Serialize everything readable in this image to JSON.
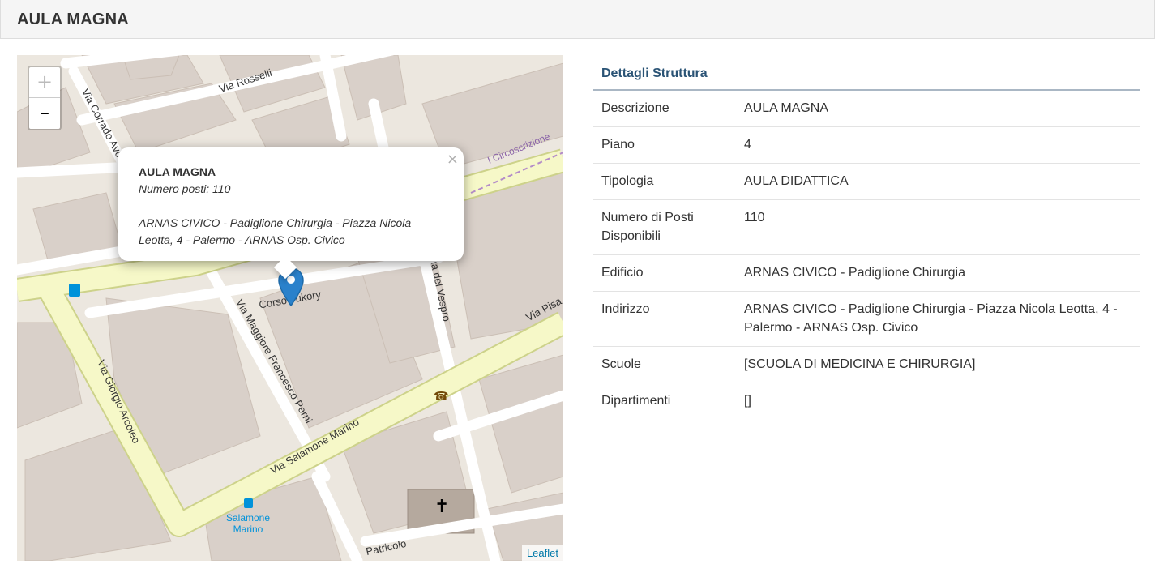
{
  "page": {
    "title": "AULA MAGNA"
  },
  "map": {
    "zoom_in": "+",
    "zoom_out": "–",
    "attribution": "Leaflet",
    "popup": {
      "title": "AULA MAGNA",
      "posti": "Numero posti: 110",
      "indirizzo": "ARNAS CIVICO - Padiglione Chirurgia - Piazza Nicola Leotta, 4 - Palermo - ARNAS Osp. Civico",
      "close": "×"
    },
    "street_labels": {
      "via_rosselli": "Via Rosselli",
      "via_corrado_avolio": "Via Corrado Avollo",
      "corso_tukory": "Corso Tukory",
      "via_maggiore": "Via Maggiore Francesco Perni",
      "via_salamone": "Via Salamone Marino",
      "via_giorgio": "Via Giorgio Arcoleo",
      "via_vespro": "Via del Vespro",
      "via_pisa": "Via Pisa",
      "circoscrizione": "I Circoscrizione",
      "bus_stop": "Salamone Marino",
      "patricolo": "Patricolo"
    },
    "icons": [
      "fuel-icon",
      "bus-stop-icon",
      "phone-icon",
      "church-cross-icon",
      "map-marker-icon"
    ]
  },
  "details": {
    "title": "Dettagli Struttura",
    "rows": [
      {
        "label": "Descrizione",
        "value": "AULA MAGNA"
      },
      {
        "label": "Piano",
        "value": "4"
      },
      {
        "label": "Tipologia",
        "value": "AULA DIDATTICA"
      },
      {
        "label": "Numero di Posti Disponibili",
        "value": "110"
      },
      {
        "label": "Edificio",
        "value": "ARNAS CIVICO - Padiglione Chirurgia"
      },
      {
        "label": "Indirizzo",
        "value": "ARNAS CIVICO - Padiglione Chirurgia - Piazza Nicola Leotta, 4 - Palermo - ARNAS Osp. Civico"
      },
      {
        "label": "Scuole",
        "value": "[SCUOLA DI MEDICINA E CHIRURGIA]"
      },
      {
        "label": "Dipartimenti",
        "value": "[]"
      }
    ]
  },
  "colors": {
    "header_bg": "#f5f5f5",
    "details_title": "#2a5375",
    "marker": "#2a81cb",
    "main_road": "#f6f8c8",
    "building": "#d9d0c9"
  }
}
